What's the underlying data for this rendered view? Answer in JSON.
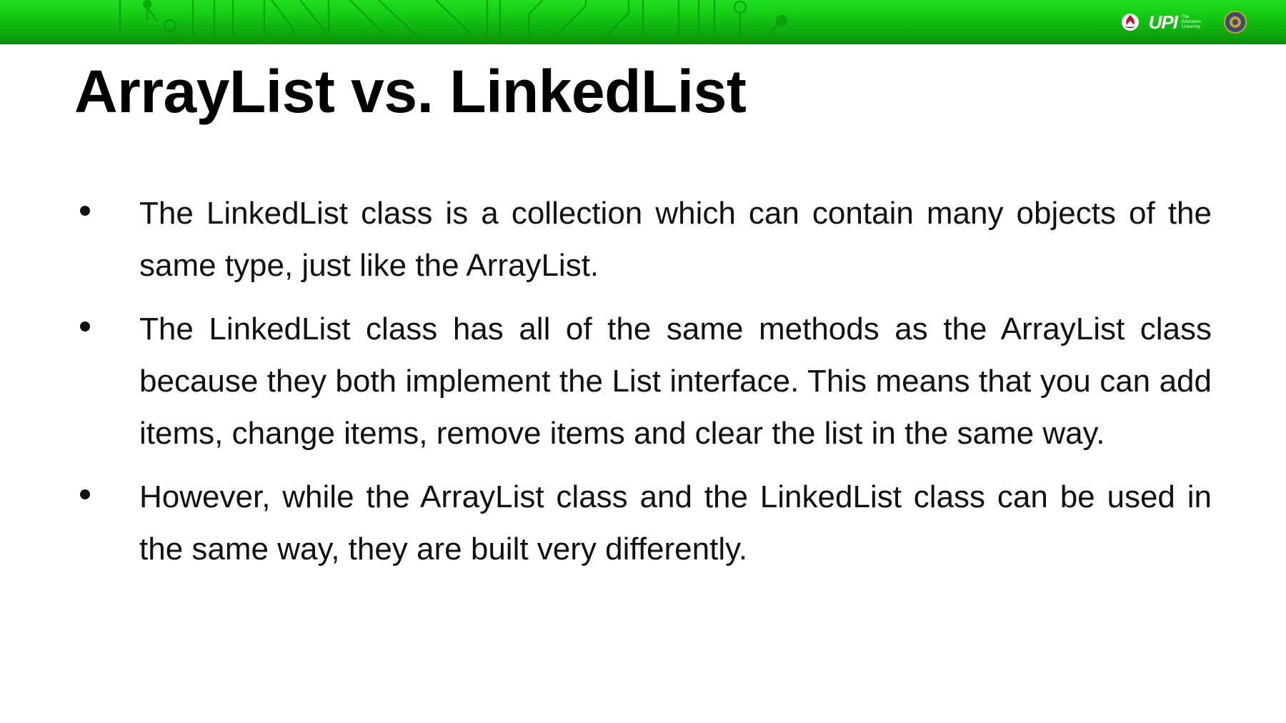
{
  "header": {
    "logo_text": "UPI",
    "logo_subtext": [
      "The",
      "Education",
      "University"
    ]
  },
  "slide": {
    "title": "ArrayList vs. LinkedList",
    "bullets": [
      "The LinkedList class is a collection which can contain many objects of the same type, just like the ArrayList.",
      "The LinkedList class has all of the same methods as the ArrayList class because they both implement the List interface. This means that you can add items, change items, remove items and clear the list in the same way.",
      "However, while the ArrayList class and the LinkedList class can be used in the same way, they are built very differently."
    ]
  },
  "colors": {
    "banner_light": "#1fe01f",
    "banner_dark": "#0b8f0b",
    "text": "#111111",
    "background": "#ffffff"
  }
}
